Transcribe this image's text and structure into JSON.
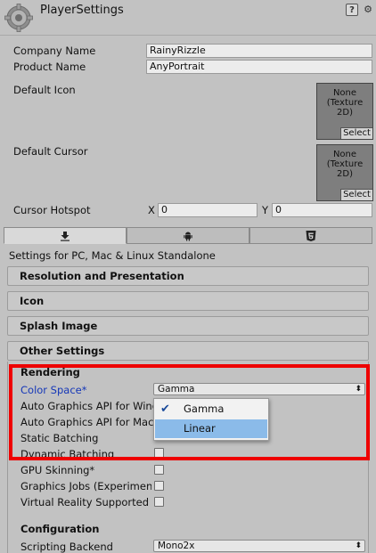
{
  "header": {
    "title": "PlayerSettings",
    "help_icon": "help-icon",
    "settings_icon": "gear-icon"
  },
  "identity": {
    "company_label": "Company Name",
    "company_value": "RainyRizzle",
    "product_label": "Product Name",
    "product_value": "AnyPortrait",
    "default_icon_label": "Default Icon",
    "default_cursor_label": "Default Cursor",
    "texture_none": "None\n(Texture\n2D)",
    "select_label": "Select",
    "hotspot_label": "Cursor Hotspot",
    "hotspot_x_label": "X",
    "hotspot_x": "0",
    "hotspot_y_label": "Y",
    "hotspot_y": "0"
  },
  "platform_tabs": [
    "download-icon",
    "android-icon",
    "html5-icon"
  ],
  "settings_for": "Settings for PC, Mac & Linux Standalone",
  "sections": {
    "resolution": "Resolution and Presentation",
    "icon": "Icon",
    "splash": "Splash Image",
    "other": "Other Settings"
  },
  "other": {
    "rendering": "Rendering",
    "color_space_label": "Color Space*",
    "color_space_value": "Gamma",
    "auto_api_win": "Auto Graphics API for Windows",
    "auto_api_mac": "Auto Graphics API for Mac",
    "static_batching": "Static Batching",
    "dynamic_batching": "Dynamic Batching",
    "gpu_skinning": "GPU Skinning*",
    "graphics_jobs": "Graphics Jobs (Experimental)",
    "vr_supported": "Virtual Reality Supported",
    "configuration": "Configuration",
    "scripting_backend_label": "Scripting Backend",
    "scripting_backend_value": "Mono2x"
  },
  "popup": {
    "options": [
      "Gamma",
      "Linear"
    ],
    "checked": "Gamma",
    "highlighted": "Linear"
  },
  "colors": {
    "highlight": "#ee0000",
    "selection": "#8bbbe9",
    "label_blue": "#1537b8"
  }
}
